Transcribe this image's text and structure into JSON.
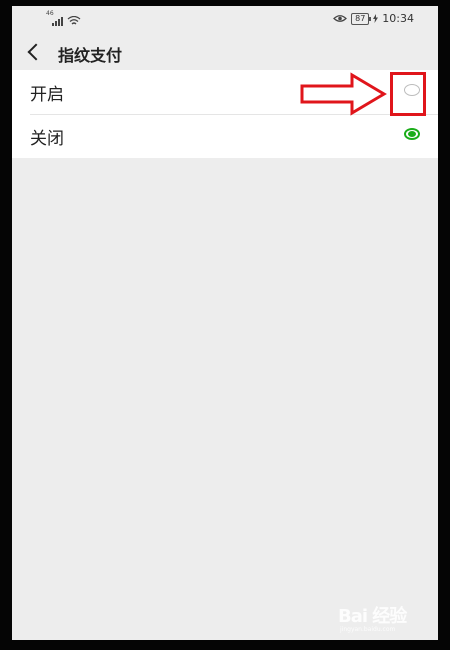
{
  "status_bar": {
    "signal_tag": "46",
    "battery": "87",
    "time": "10:34",
    "icons": [
      "signal-icon",
      "wifi-icon",
      "eye-icon",
      "battery-icon",
      "charging-icon"
    ]
  },
  "nav": {
    "back_icon": "chevron-left-icon",
    "title": "指纹支付"
  },
  "options": [
    {
      "label": "开启",
      "selected": false
    },
    {
      "label": "关闭",
      "selected": true
    }
  ],
  "annotation": {
    "color": "#e0151b"
  },
  "watermark": {
    "text": "Bai 经验",
    "sub": "jingyan.baidu.com"
  },
  "colors": {
    "accent": "#1aad19",
    "background": "#ededed",
    "annotation": "#e0151b"
  }
}
